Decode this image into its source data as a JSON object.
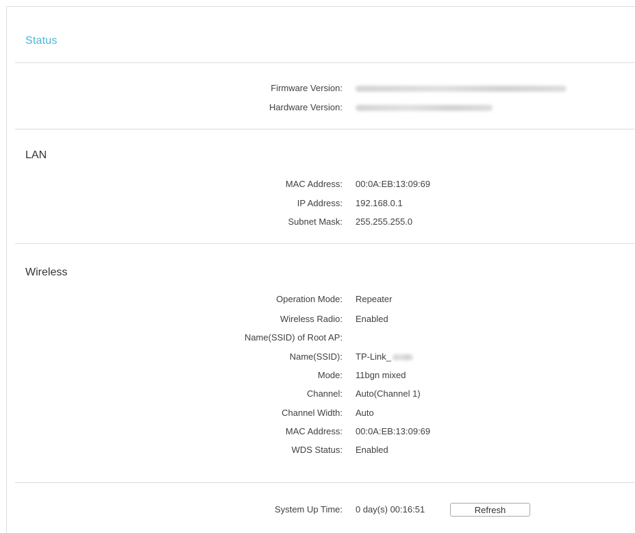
{
  "title": "Status",
  "firmware": {
    "firmware_version_label": "Firmware Version:",
    "hardware_version_label": "Hardware Version:"
  },
  "lan": {
    "title": "LAN",
    "mac_label": "MAC Address:",
    "mac_value": "00:0A:EB:13:09:69",
    "ip_label": "IP Address:",
    "ip_value": "192.168.0.1",
    "subnet_label": "Subnet Mask:",
    "subnet_value": "255.255.255.0"
  },
  "wireless": {
    "title": "Wireless",
    "operation_mode_label": "Operation Mode:",
    "operation_mode_value": "Repeater",
    "radio_label": "Wireless Radio:",
    "radio_value": "Enabled",
    "root_ssid_label": "Name(SSID) of Root AP:",
    "ssid_label": "Name(SSID):",
    "ssid_value": "TP-Link_",
    "mode_label": "Mode:",
    "mode_value": "11bgn mixed",
    "channel_label": "Channel:",
    "channel_value": "Auto(Channel 1)",
    "channel_width_label": "Channel Width:",
    "channel_width_value": "Auto",
    "mac_label": "MAC Address:",
    "mac_value": "00:0A:EB:13:09:69",
    "wds_label": "WDS Status:",
    "wds_value": "Enabled"
  },
  "system": {
    "uptime_label": "System Up Time:",
    "uptime_value": "0 day(s) 00:16:51",
    "refresh_label": "Refresh"
  }
}
